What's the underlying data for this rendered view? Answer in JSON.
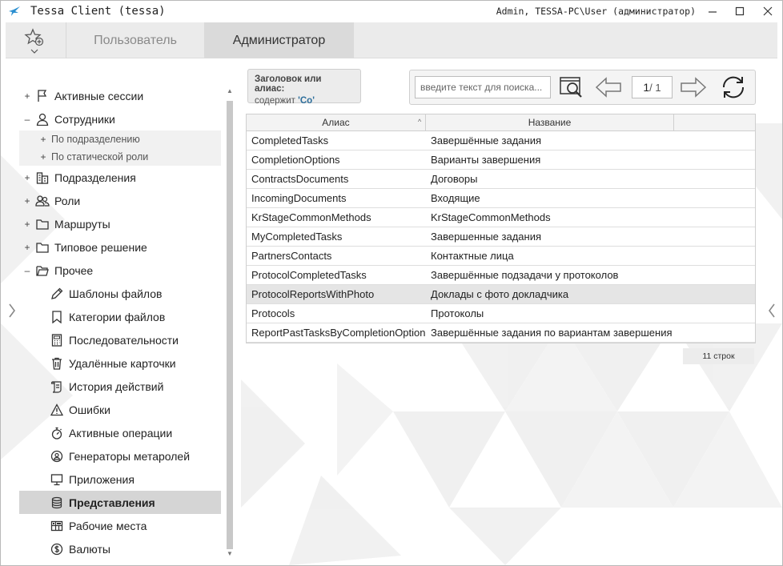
{
  "window": {
    "title": "Tessa Client (tessa)",
    "user": "Admin, TESSA-PC\\User (администратор)"
  },
  "tabs": [
    {
      "label": "Пользователь"
    },
    {
      "label": "Администратор"
    }
  ],
  "tree": [
    {
      "label": "Активные сессии",
      "expander": "+",
      "icon": "flag-icon"
    },
    {
      "label": "Сотрудники",
      "expander": "–",
      "icon": "person-icon"
    },
    {
      "label": "По подразделению",
      "expander": "+",
      "small": true
    },
    {
      "label": "По статической роли",
      "expander": "+",
      "small": true
    },
    {
      "label": "Подразделения",
      "expander": "+",
      "icon": "building-icon"
    },
    {
      "label": "Роли",
      "expander": "+",
      "icon": "users-icon"
    },
    {
      "label": "Маршруты",
      "expander": "+",
      "icon": "folder-icon"
    },
    {
      "label": "Типовое решение",
      "expander": "+",
      "icon": "folder-icon"
    },
    {
      "label": "Прочее",
      "expander": "–",
      "icon": "folder-open-icon"
    },
    {
      "label": "Шаблоны файлов",
      "icon": "pencil-icon"
    },
    {
      "label": "Категории файлов",
      "icon": "bookmark-icon"
    },
    {
      "label": "Последовательности",
      "icon": "calculator-icon"
    },
    {
      "label": "Удалённые карточки",
      "icon": "trash-icon"
    },
    {
      "label": "История действий",
      "icon": "scroll-icon"
    },
    {
      "label": "Ошибки",
      "icon": "warning-icon"
    },
    {
      "label": "Активные операции",
      "icon": "stopwatch-icon"
    },
    {
      "label": "Генераторы метаролей",
      "icon": "user-badge-icon"
    },
    {
      "label": "Приложения",
      "icon": "monitor-icon"
    },
    {
      "label": "Представления",
      "icon": "database-icon",
      "active": true
    },
    {
      "label": "Рабочие места",
      "icon": "layout-icon"
    },
    {
      "label": "Валюты",
      "icon": "dollar-icon"
    }
  ],
  "filter": {
    "title": "Заголовок или алиас:",
    "prefix": "содержит",
    "value": "'Co'"
  },
  "search": {
    "placeholder": "введите текст для поиска..."
  },
  "paging": {
    "current": "1",
    "total": "/ 1"
  },
  "table": {
    "columns": [
      "Алиас",
      "Название"
    ],
    "rows": [
      {
        "alias": "CompletedTasks",
        "name": "Завершённые задания"
      },
      {
        "alias": "CompletionOptions",
        "name": "Варианты завершения"
      },
      {
        "alias": "ContractsDocuments",
        "name": "Договоры"
      },
      {
        "alias": "IncomingDocuments",
        "name": "Входящие"
      },
      {
        "alias": "KrStageCommonMethods",
        "name": "KrStageCommonMethods"
      },
      {
        "alias": "MyCompletedTasks",
        "name": "Завершенные задания"
      },
      {
        "alias": "PartnersContacts",
        "name": "Контактные лица"
      },
      {
        "alias": "ProtocolCompletedTasks",
        "name": "Завершённые подзадачи у протоколов"
      },
      {
        "alias": "ProtocolReportsWithPhoto",
        "name": "Доклады с фото докладчика",
        "selected": true
      },
      {
        "alias": "Protocols",
        "name": "Протоколы"
      },
      {
        "alias": "ReportPastTasksByCompletionOption",
        "name": "Завершённые задания по вариантам завершения"
      }
    ]
  },
  "row_count": "11 строк",
  "colors": {
    "active_item": "#d5d5d5",
    "selected_row": "#e5e5e5",
    "accent": "#2d6e9b"
  }
}
